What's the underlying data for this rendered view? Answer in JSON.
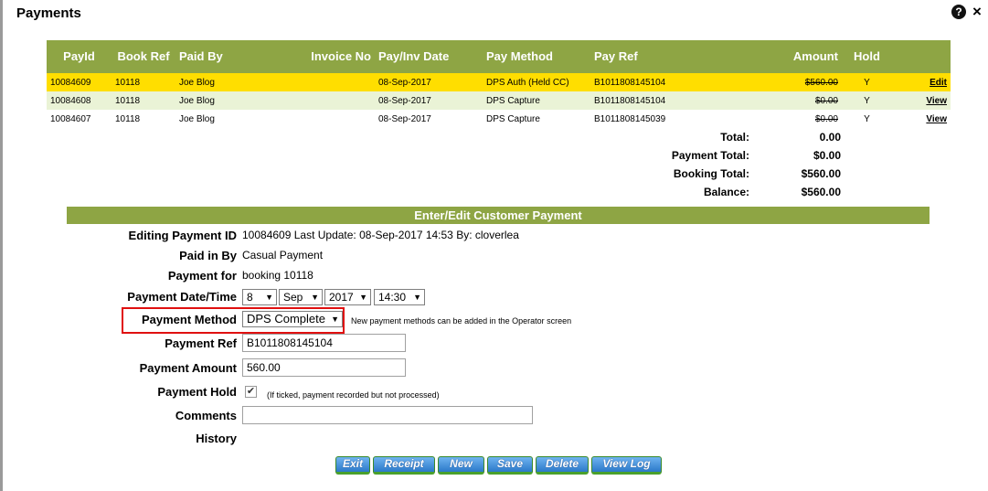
{
  "dialog": {
    "title": "Payments"
  },
  "table": {
    "headers": [
      "PayId",
      "Book Ref",
      "Paid By",
      "Invoice No",
      "Pay/Inv Date",
      "Pay Method",
      "Pay Ref",
      "Amount",
      "Hold",
      ""
    ],
    "rows": [
      {
        "payid": "10084609",
        "bookref": "10118",
        "paidby": "Joe Blog",
        "invoice": "",
        "date": "08-Sep-2017",
        "method": "DPS Auth (Held CC)",
        "ref": "B1011808145104",
        "amount": "$560.00",
        "hold": "Y",
        "action": "Edit"
      },
      {
        "payid": "10084608",
        "bookref": "10118",
        "paidby": "Joe Blog",
        "invoice": "",
        "date": "08-Sep-2017",
        "method": "DPS Capture",
        "ref": "B1011808145104",
        "amount": "$0.00",
        "hold": "Y",
        "action": "View"
      },
      {
        "payid": "10084607",
        "bookref": "10118",
        "paidby": "Joe Blog",
        "invoice": "",
        "date": "08-Sep-2017",
        "method": "DPS Capture",
        "ref": "B1011808145039",
        "amount": "$0.00",
        "hold": "Y",
        "action": "View"
      }
    ]
  },
  "totals": [
    {
      "label": "Total:",
      "value": "0.00"
    },
    {
      "label": "Payment Total:",
      "value": "$0.00"
    },
    {
      "label": "Booking Total:",
      "value": "$560.00"
    },
    {
      "label": "Balance:",
      "value": "$560.00"
    }
  ],
  "form": {
    "section_title": "Enter/Edit Customer Payment",
    "editing_label": "Editing Payment ID",
    "editing_value": "10084609 Last Update: 08-Sep-2017 14:53 By: cloverlea",
    "paidin_label": "Paid in By",
    "paidin_value": "Casual Payment",
    "payfor_label": "Payment for",
    "payfor_value": "booking 10118",
    "datetime_label": "Payment Date/Time",
    "day": "8",
    "month": "Sep",
    "year": "2017",
    "time": "14:30",
    "method_label": "Payment Method",
    "method_value": "DPS Complete",
    "method_hint": "New payment methods can be added in the Operator screen",
    "ref_label": "Payment Ref",
    "ref_value": "B1011808145104",
    "amount_label": "Payment Amount",
    "amount_value": "560.00",
    "hold_label": "Payment Hold",
    "hold_checked": "✔",
    "hold_hint": "(If ticked, payment recorded but not processed)",
    "comments_label": "Comments",
    "comments_value": "",
    "history_label": "History"
  },
  "buttons": [
    "Exit",
    "Receipt",
    "New",
    "Save",
    "Delete",
    "View Log"
  ],
  "colors": {
    "header_green": "#8ea544",
    "selected_row": "#ffde00",
    "alt_row": "#eaf3d6",
    "highlight_red": "#e01010"
  }
}
